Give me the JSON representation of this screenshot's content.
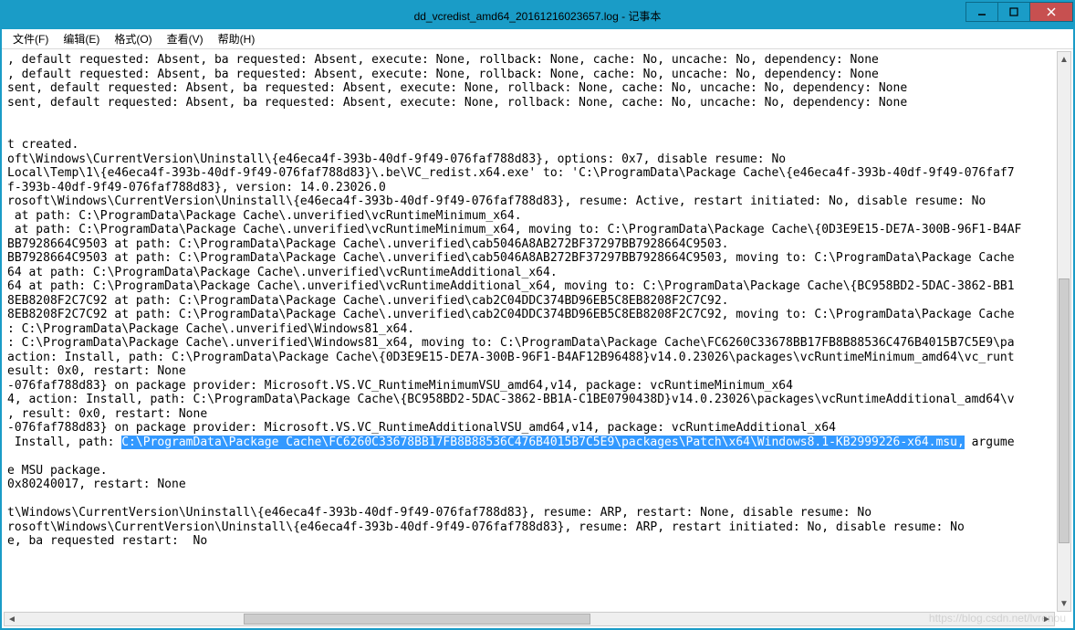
{
  "window": {
    "title": "dd_vcredist_amd64_20161216023657.log - 记事本"
  },
  "menu": {
    "file": "文件(F)",
    "edit": "编辑(E)",
    "format": "格式(O)",
    "view": "查看(V)",
    "help": "帮助(H)"
  },
  "log": {
    "lines": [
      ", default requested: Absent, ba requested: Absent, execute: None, rollback: None, cache: No, uncache: No, dependency: None",
      ", default requested: Absent, ba requested: Absent, execute: None, rollback: None, cache: No, uncache: No, dependency: None",
      "sent, default requested: Absent, ba requested: Absent, execute: None, rollback: None, cache: No, uncache: No, dependency: None",
      "sent, default requested: Absent, ba requested: Absent, execute: None, rollback: None, cache: No, uncache: No, dependency: None",
      "",
      "",
      "t created.",
      "oft\\Windows\\CurrentVersion\\Uninstall\\{e46eca4f-393b-40df-9f49-076faf788d83}, options: 0x7, disable resume: No",
      "Local\\Temp\\1\\{e46eca4f-393b-40df-9f49-076faf788d83}\\.be\\VC_redist.x64.exe' to: 'C:\\ProgramData\\Package Cache\\{e46eca4f-393b-40df-9f49-076faf7",
      "f-393b-40df-9f49-076faf788d83}, version: 14.0.23026.0",
      "rosoft\\Windows\\CurrentVersion\\Uninstall\\{e46eca4f-393b-40df-9f49-076faf788d83}, resume: Active, restart initiated: No, disable resume: No",
      " at path: C:\\ProgramData\\Package Cache\\.unverified\\vcRuntimeMinimum_x64.",
      " at path: C:\\ProgramData\\Package Cache\\.unverified\\vcRuntimeMinimum_x64, moving to: C:\\ProgramData\\Package Cache\\{0D3E9E15-DE7A-300B-96F1-B4AF",
      "BB7928664C9503 at path: C:\\ProgramData\\Package Cache\\.unverified\\cab5046A8AB272BF37297BB7928664C9503.",
      "BB7928664C9503 at path: C:\\ProgramData\\Package Cache\\.unverified\\cab5046A8AB272BF37297BB7928664C9503, moving to: C:\\ProgramData\\Package Cache",
      "64 at path: C:\\ProgramData\\Package Cache\\.unverified\\vcRuntimeAdditional_x64.",
      "64 at path: C:\\ProgramData\\Package Cache\\.unverified\\vcRuntimeAdditional_x64, moving to: C:\\ProgramData\\Package Cache\\{BC958BD2-5DAC-3862-BB1",
      "8EB8208F2C7C92 at path: C:\\ProgramData\\Package Cache\\.unverified\\cab2C04DDC374BD96EB5C8EB8208F2C7C92.",
      "8EB8208F2C7C92 at path: C:\\ProgramData\\Package Cache\\.unverified\\cab2C04DDC374BD96EB5C8EB8208F2C7C92, moving to: C:\\ProgramData\\Package Cache",
      ": C:\\ProgramData\\Package Cache\\.unverified\\Windows81_x64.",
      ": C:\\ProgramData\\Package Cache\\.unverified\\Windows81_x64, moving to: C:\\ProgramData\\Package Cache\\FC6260C33678BB17FB8B88536C476B4015B7C5E9\\pa",
      "action: Install, path: C:\\ProgramData\\Package Cache\\{0D3E9E15-DE7A-300B-96F1-B4AF12B96488}v14.0.23026\\packages\\vcRuntimeMinimum_amd64\\vc_runt",
      "esult: 0x0, restart: None",
      "-076faf788d83} on package provider: Microsoft.VS.VC_RuntimeMinimumVSU_amd64,v14, package: vcRuntimeMinimum_x64",
      "4, action: Install, path: C:\\ProgramData\\Package Cache\\{BC958BD2-5DAC-3862-BB1A-C1BE0790438D}v14.0.23026\\packages\\vcRuntimeAdditional_amd64\\v",
      ", result: 0x0, restart: None",
      "-076faf788d83} on package provider: Microsoft.VS.VC_RuntimeAdditionalVSU_amd64,v14, package: vcRuntimeAdditional_x64"
    ],
    "install_prefix": " Install, path: ",
    "install_highlight": "C:\\ProgramData\\Package Cache\\FC6260C33678BB17FB8B88536C476B4015B7C5E9\\packages\\Patch\\x64\\Windows8.1-KB2999226-x64.msu,",
    "install_suffix": " argume",
    "lines_after": [
      "",
      "e MSU package.",
      "0x80240017, restart: None",
      "",
      "t\\Windows\\CurrentVersion\\Uninstall\\{e46eca4f-393b-40df-9f49-076faf788d83}, resume: ARP, restart: None, disable resume: No",
      "rosoft\\Windows\\CurrentVersion\\Uninstall\\{e46eca4f-393b-40df-9f49-076faf788d83}, resume: ARP, restart initiated: No, disable resume: No",
      "e, ba requested restart:  No"
    ]
  },
  "watermark": "https://blog.csdn.net/lvrenou"
}
